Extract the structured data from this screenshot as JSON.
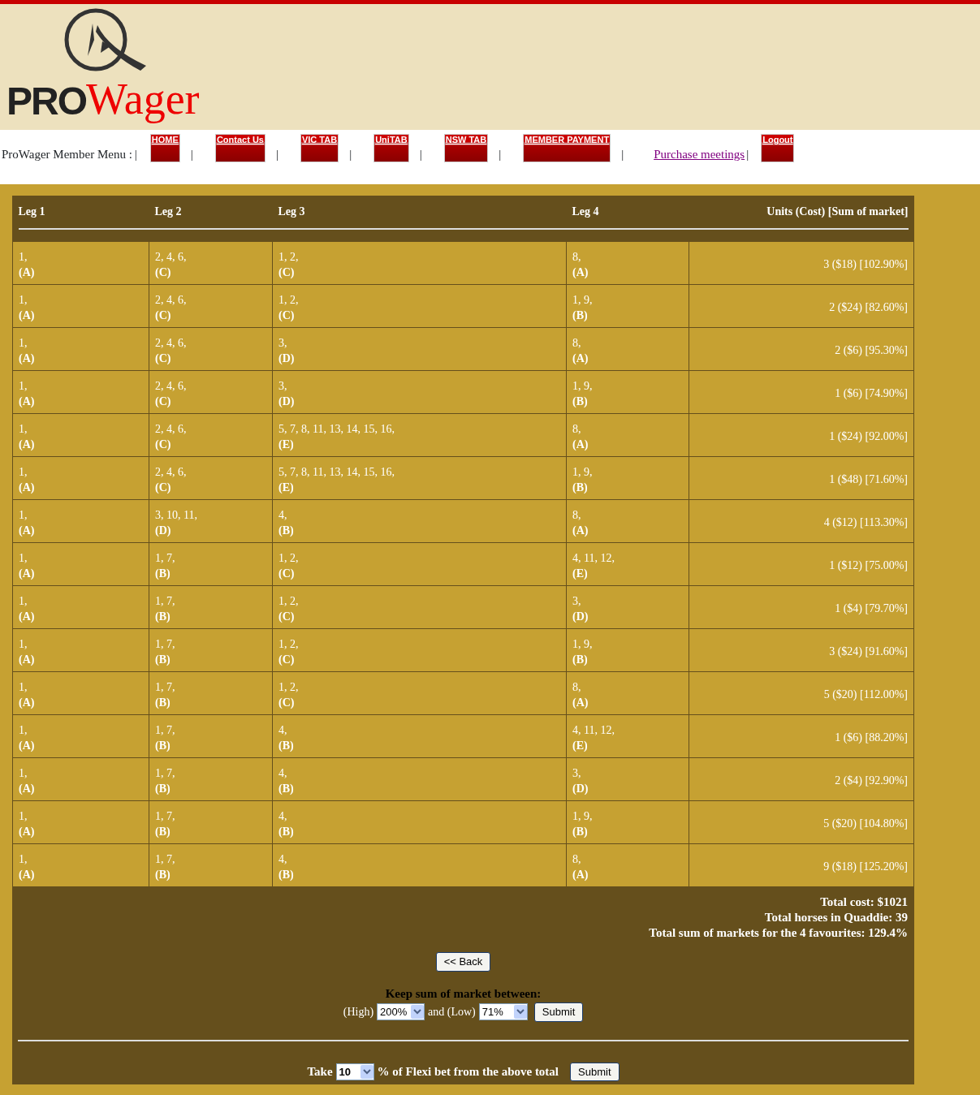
{
  "logo": {
    "part_1": "PRO",
    "part_2": "Wager"
  },
  "menu": {
    "label": "ProWager Member Menu :",
    "label_separator": "|",
    "items": [
      {
        "kind": "image_button",
        "label": "HOME",
        "separator": "|"
      },
      {
        "kind": "image_button",
        "label": "Contact Us",
        "separator": "|"
      },
      {
        "kind": "image_button",
        "label": "VIC TAB",
        "separator": "|"
      },
      {
        "kind": "image_button",
        "label": "UniTAB",
        "separator": "|"
      },
      {
        "kind": "image_button",
        "label": "NSW TAB",
        "separator": "|"
      },
      {
        "kind": "image_button",
        "label": "MEMBER PAYMENT",
        "separator": "|"
      },
      {
        "kind": "link",
        "label": "Purchase meetings",
        "separator": "|"
      },
      {
        "kind": "image_button",
        "label": "Logout"
      }
    ]
  },
  "table": {
    "columns": [
      "Leg 1",
      "Leg 2",
      "Leg 3",
      "Leg 4",
      "Units (Cost) [Sum of market]"
    ],
    "rows": [
      {
        "legs": [
          [
            "1,",
            "(A)"
          ],
          [
            "2, 4, 6,",
            "(C)"
          ],
          [
            "1, 2,",
            "(C)"
          ],
          [
            "8,",
            "(A)"
          ]
        ],
        "units": "3 ($18) [102.90%]"
      },
      {
        "legs": [
          [
            "1,",
            "(A)"
          ],
          [
            "2, 4, 6,",
            "(C)"
          ],
          [
            "1, 2,",
            "(C)"
          ],
          [
            "1, 9,",
            "(B)"
          ]
        ],
        "units": "2 ($24) [82.60%]"
      },
      {
        "legs": [
          [
            "1,",
            "(A)"
          ],
          [
            "2, 4, 6,",
            "(C)"
          ],
          [
            "3,",
            "(D)"
          ],
          [
            "8,",
            "(A)"
          ]
        ],
        "units": "2 ($6) [95.30%]"
      },
      {
        "legs": [
          [
            "1,",
            "(A)"
          ],
          [
            "2, 4, 6,",
            "(C)"
          ],
          [
            "3,",
            "(D)"
          ],
          [
            "1, 9,",
            "(B)"
          ]
        ],
        "units": "1 ($6) [74.90%]"
      },
      {
        "legs": [
          [
            "1,",
            "(A)"
          ],
          [
            "2, 4, 6,",
            "(C)"
          ],
          [
            "5, 7, 8, 11, 13, 14, 15, 16,",
            "(E)"
          ],
          [
            "8,",
            "(A)"
          ]
        ],
        "units": "1 ($24) [92.00%]"
      },
      {
        "legs": [
          [
            "1,",
            "(A)"
          ],
          [
            "2, 4, 6,",
            "(C)"
          ],
          [
            "5, 7, 8, 11, 13, 14, 15, 16,",
            "(E)"
          ],
          [
            "1, 9,",
            "(B)"
          ]
        ],
        "units": "1 ($48) [71.60%]"
      },
      {
        "legs": [
          [
            "1,",
            "(A)"
          ],
          [
            "3, 10, 11,",
            "(D)"
          ],
          [
            "4,",
            "(B)"
          ],
          [
            "8,",
            "(A)"
          ]
        ],
        "units": "4 ($12) [113.30%]"
      },
      {
        "legs": [
          [
            "1,",
            "(A)"
          ],
          [
            "1, 7,",
            "(B)"
          ],
          [
            "1, 2,",
            "(C)"
          ],
          [
            "4, 11, 12,",
            "(E)"
          ]
        ],
        "units": "1 ($12) [75.00%]"
      },
      {
        "legs": [
          [
            "1,",
            "(A)"
          ],
          [
            "1, 7,",
            "(B)"
          ],
          [
            "1, 2,",
            "(C)"
          ],
          [
            "3,",
            "(D)"
          ]
        ],
        "units": "1 ($4) [79.70%]"
      },
      {
        "legs": [
          [
            "1,",
            "(A)"
          ],
          [
            "1, 7,",
            "(B)"
          ],
          [
            "1, 2,",
            "(C)"
          ],
          [
            "1, 9,",
            "(B)"
          ]
        ],
        "units": "3 ($24) [91.60%]"
      },
      {
        "legs": [
          [
            "1,",
            "(A)"
          ],
          [
            "1, 7,",
            "(B)"
          ],
          [
            "1, 2,",
            "(C)"
          ],
          [
            "8,",
            "(A)"
          ]
        ],
        "units": "5 ($20) [112.00%]"
      },
      {
        "legs": [
          [
            "1,",
            "(A)"
          ],
          [
            "1, 7,",
            "(B)"
          ],
          [
            "4,",
            "(B)"
          ],
          [
            "4, 11, 12,",
            "(E)"
          ]
        ],
        "units": "1 ($6) [88.20%]"
      },
      {
        "legs": [
          [
            "1,",
            "(A)"
          ],
          [
            "1, 7,",
            "(B)"
          ],
          [
            "4,",
            "(B)"
          ],
          [
            "3,",
            "(D)"
          ]
        ],
        "units": "2 ($4) [92.90%]"
      },
      {
        "legs": [
          [
            "1,",
            "(A)"
          ],
          [
            "1, 7,",
            "(B)"
          ],
          [
            "4,",
            "(B)"
          ],
          [
            "1, 9,",
            "(B)"
          ]
        ],
        "units": "5 ($20) [104.80%]"
      },
      {
        "legs": [
          [
            "1,",
            "(A)"
          ],
          [
            "1, 7,",
            "(B)"
          ],
          [
            "4,",
            "(B)"
          ],
          [
            "8,",
            "(A)"
          ]
        ],
        "units": "9 ($18) [125.20%]"
      }
    ]
  },
  "totals": [
    "Total cost: $1021",
    "Total horses in Quaddie: 39",
    "Total sum of markets for the 4 favourites: 129.4%"
  ],
  "back_button": "<< Back",
  "market_filter": {
    "title": "Keep sum of market between:",
    "high_label": "(High)",
    "high_value": "200%",
    "and_label": "and (Low)",
    "low_value": "71%",
    "submit": "Submit"
  },
  "flexi": {
    "prefix": "Take",
    "value": "10",
    "suffix": "% of Flexi bet from the above total",
    "submit": "Submit"
  }
}
